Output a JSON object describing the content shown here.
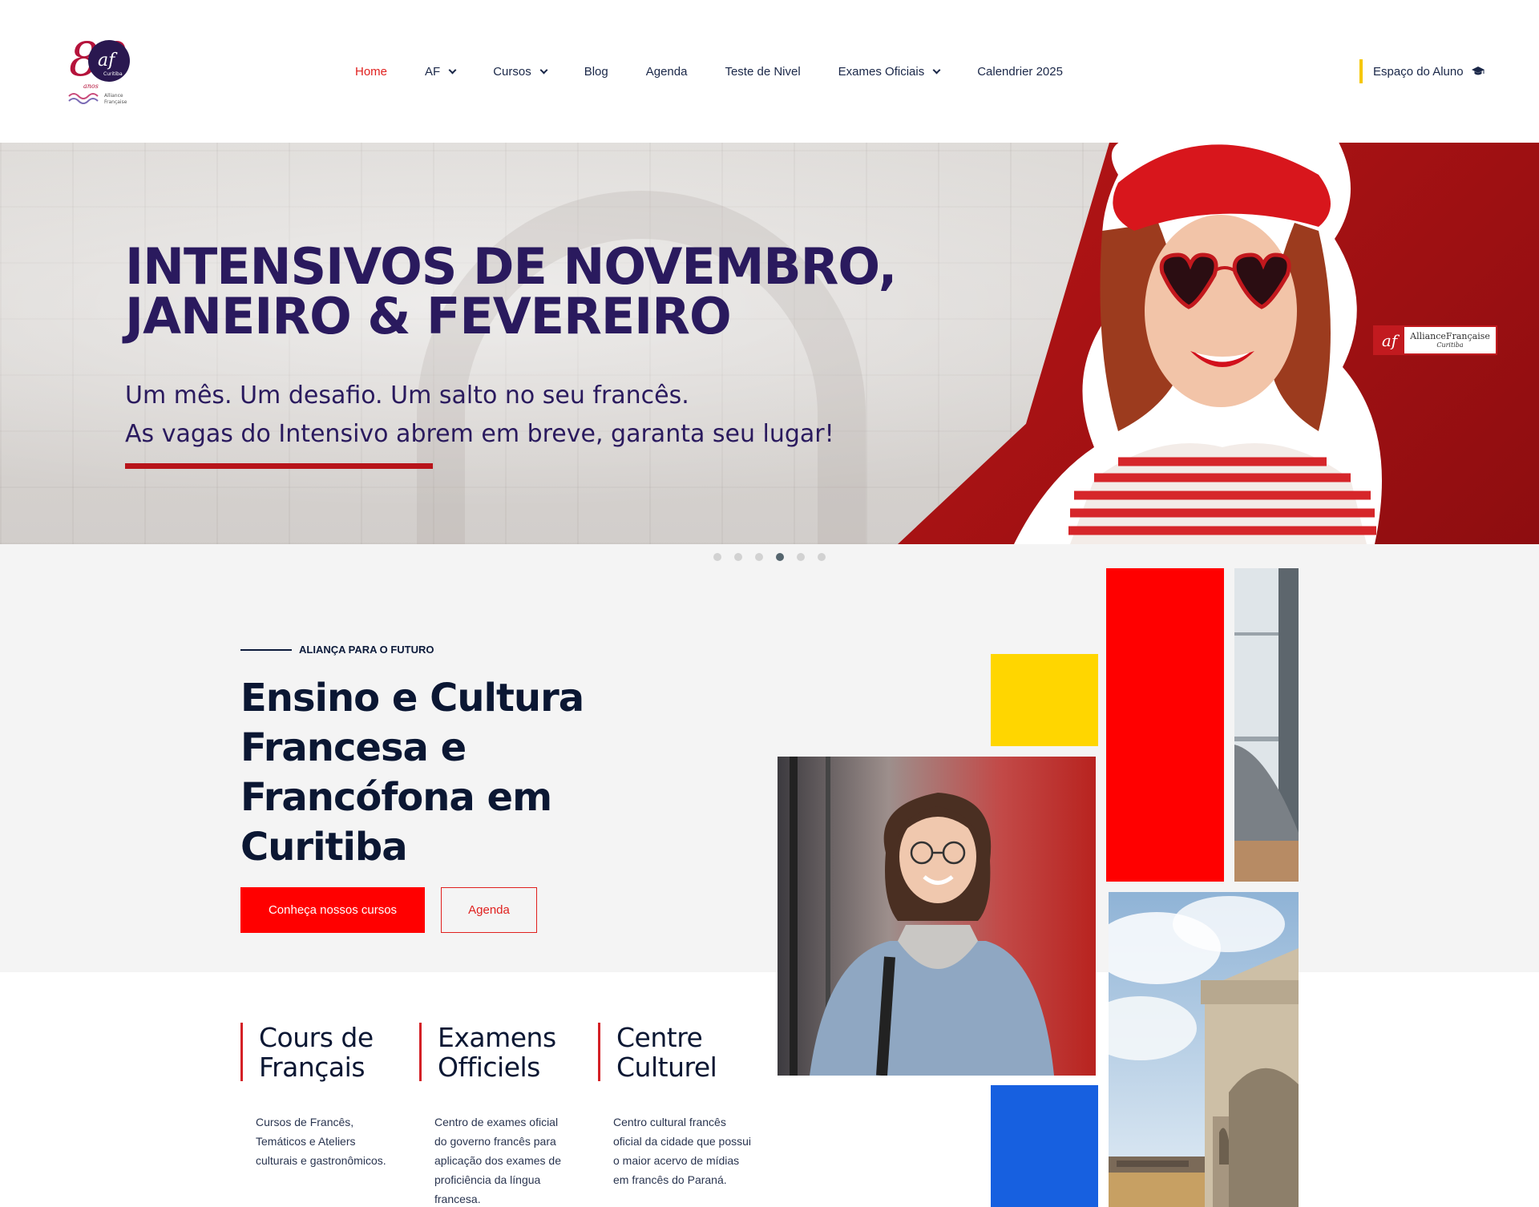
{
  "header": {
    "logo": {
      "number": "80",
      "anos": "anos",
      "mark": "af",
      "city": "Curitiba",
      "org_line1": "Alliance",
      "org_line2": "Française"
    },
    "nav": [
      {
        "label": "Home",
        "active": true,
        "dropdown": false
      },
      {
        "label": "AF",
        "active": false,
        "dropdown": true
      },
      {
        "label": "Cursos",
        "active": false,
        "dropdown": true
      },
      {
        "label": "Blog",
        "active": false,
        "dropdown": false
      },
      {
        "label": "Agenda",
        "active": false,
        "dropdown": false
      },
      {
        "label": "Teste de Nivel",
        "active": false,
        "dropdown": false
      },
      {
        "label": "Exames Oficiais",
        "active": false,
        "dropdown": true
      },
      {
        "label": "Calendrier 2025",
        "active": false,
        "dropdown": false
      }
    ],
    "student_area": {
      "label": "Espaço do Aluno",
      "icon": "graduation-cap-icon"
    }
  },
  "hero": {
    "title_line1": "INTENSIVOS DE NOVEMBRO,",
    "title_line2": "JANEIRO & FEVEREIRO",
    "subtitle_line1": "Um mês. Um desafio. Um salto no seu francês.",
    "subtitle_line2": "As vagas do Intensivo abrem em breve, garanta seu lugar!",
    "badge": {
      "mark": "af",
      "name": "AllianceFrançaise",
      "city": "Curitiba"
    }
  },
  "slider": {
    "count": 6,
    "active_index": 3
  },
  "about": {
    "eyebrow": "ALIANÇA PARA O FUTURO",
    "title": "Ensino e Cultura Francesa e Francófona em Curitiba",
    "primary_button": "Conheça nossos cursos",
    "secondary_button": "Agenda"
  },
  "features": [
    {
      "title_line1": "Cours de",
      "title_line2": "Français",
      "description": "Cursos de Francês, Temáticos e Ateliers culturais e gastronômicos."
    },
    {
      "title_line1": "Examens",
      "title_line2": "Officiels",
      "description": "Centro de exames oficial do governo francês para aplicação dos exames de proficiência da língua francesa."
    },
    {
      "title_line1": "Centre",
      "title_line2": "Culturel",
      "description": "Centro cultural francês oficial da cidade que possui o maior acervo de mídias em francês do Paraná."
    }
  ],
  "colors": {
    "accent_red": "#ff0000",
    "nav_active": "#e0201e",
    "navy": "#0b1733",
    "hero_purple": "#2a1a5e",
    "collage_yellow": "#ffd600",
    "collage_blue": "#1760e0",
    "student_bar": "#f6c700"
  }
}
